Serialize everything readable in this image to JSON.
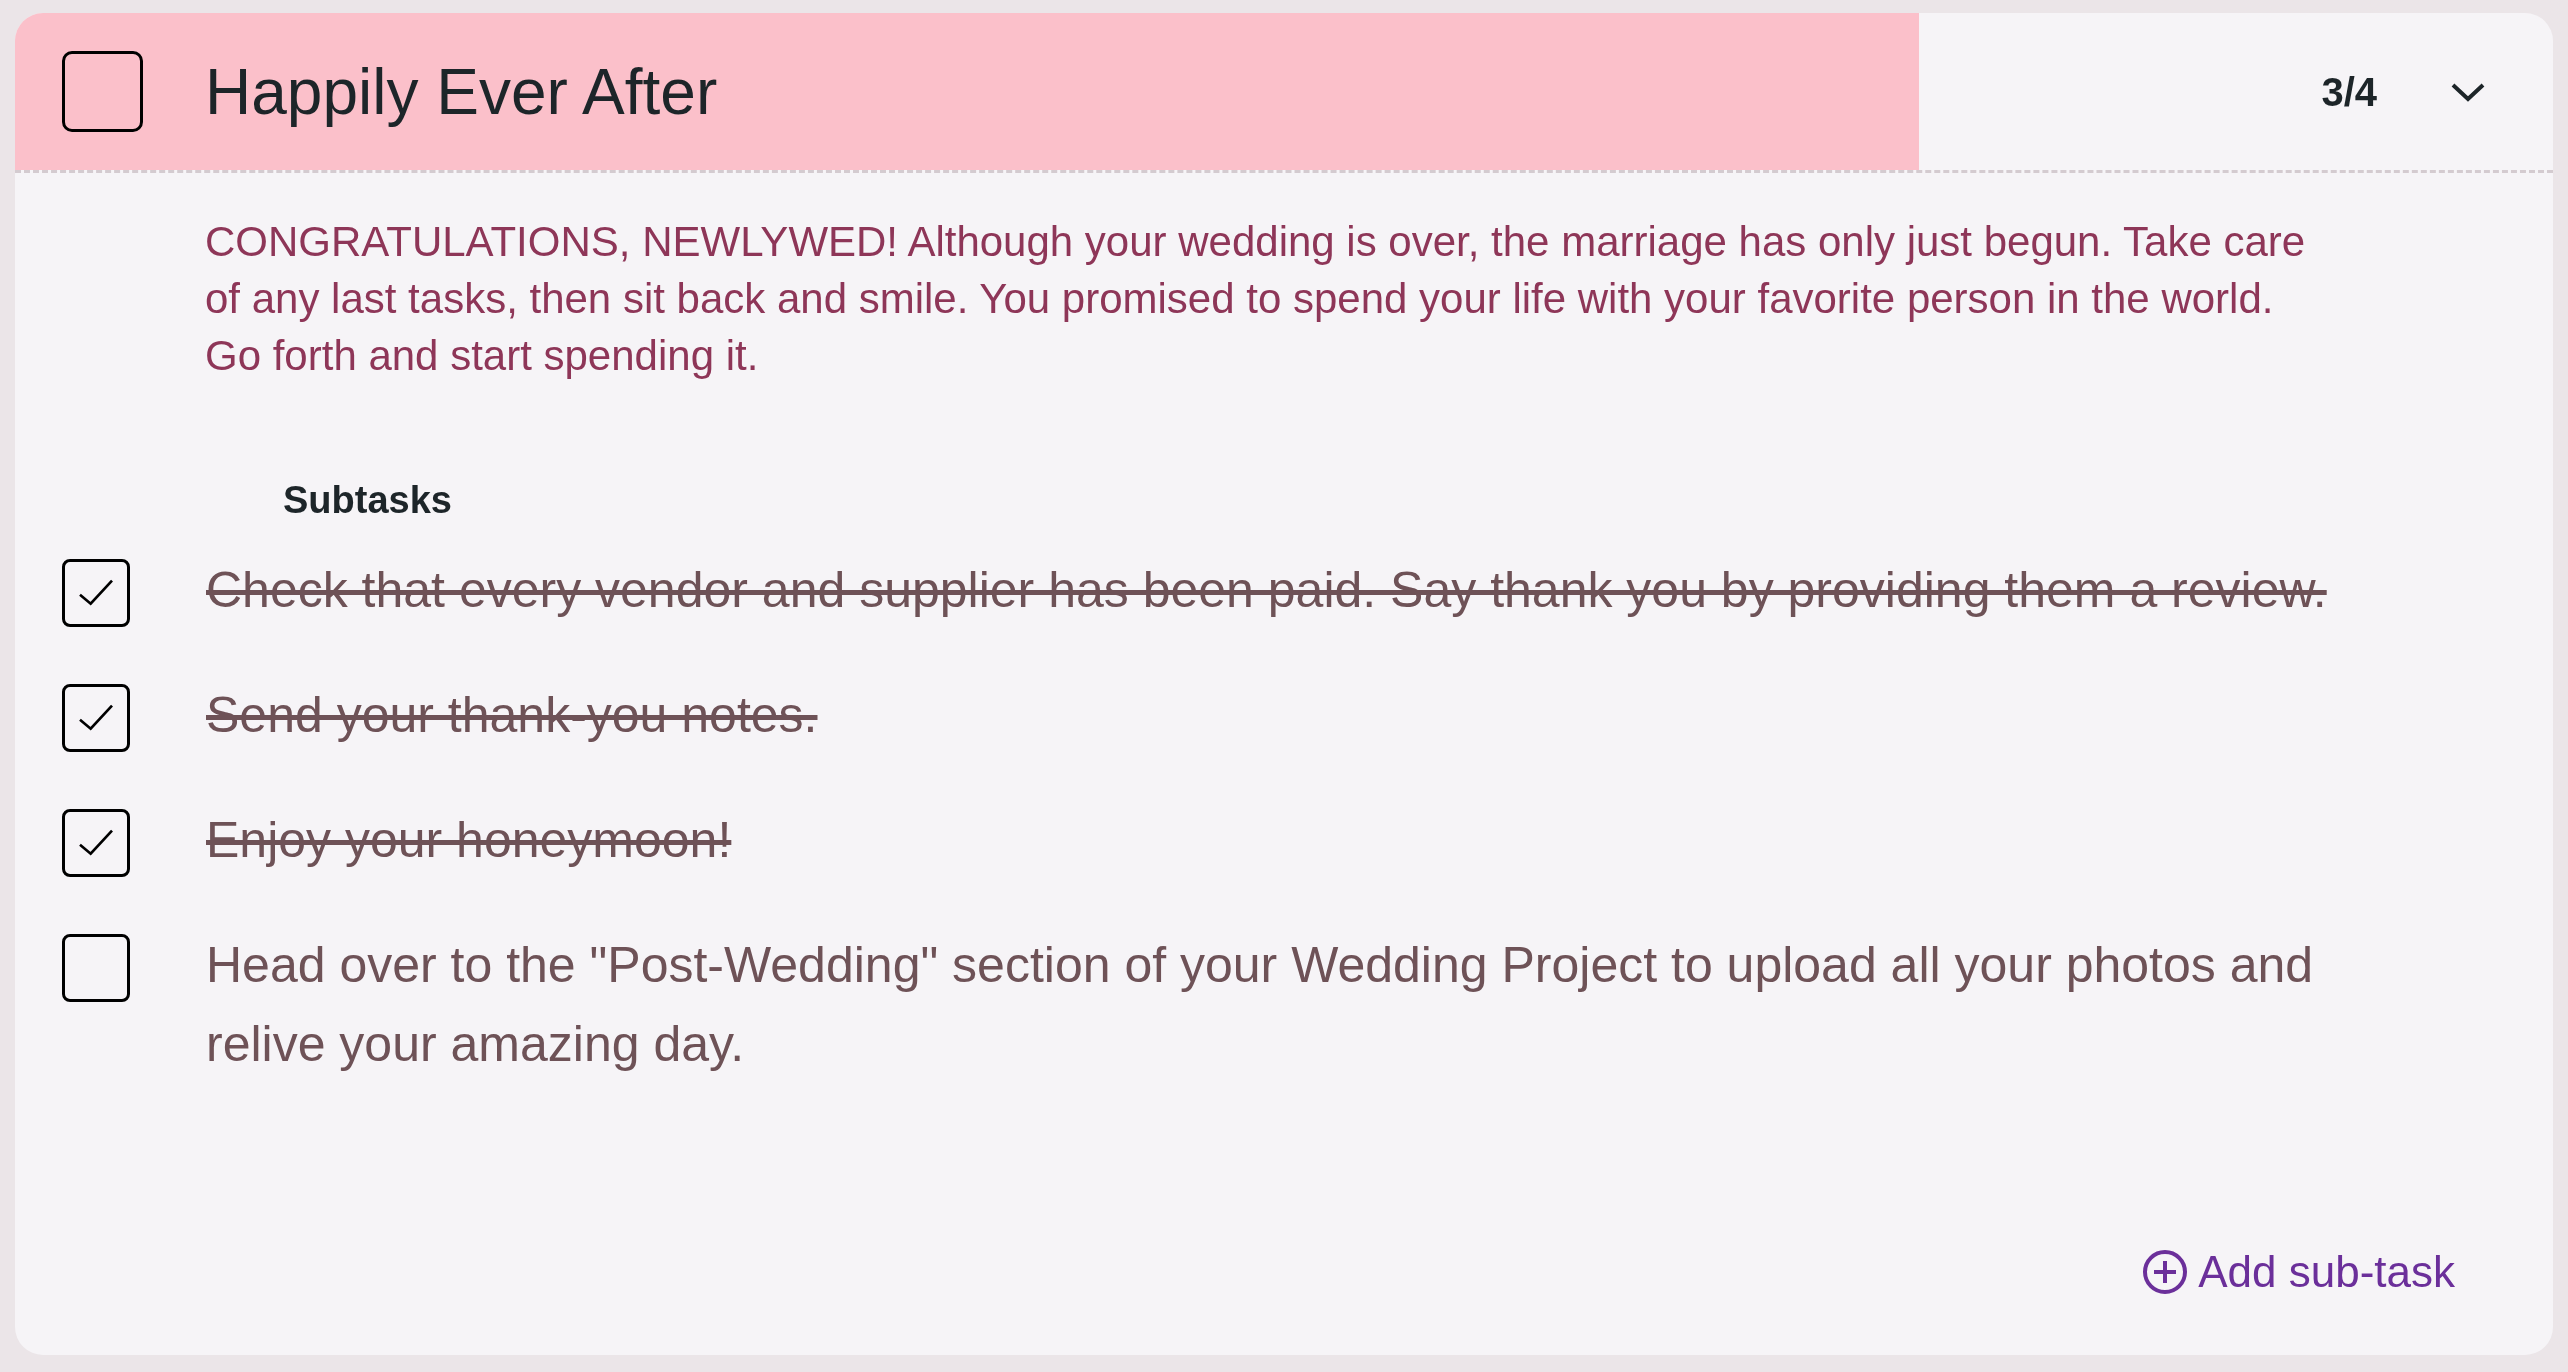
{
  "task": {
    "title": "Happily Ever After",
    "checked": false,
    "level": 0.75,
    "count": "3/4",
    "expanded": true,
    "description": "CONGRATULATIONS, NEWLYWED! Although your wedding is over, the marriage has only just begun. Take care of any last tasks, then sit back and smile. You promised to spend your life with your favorite person in the world. Go forth and start spending it."
  },
  "subtasks_heading": "Subtasks",
  "subtasks": [
    {
      "text": "Check that every vendor and supplier has been paid. Say thank you by providing them a review.",
      "checked": true
    },
    {
      "text": "Send your thank-you notes.",
      "checked": true
    },
    {
      "text": "Enjoy your honeymoon!",
      "checked": true
    },
    {
      "text": "Head over to the \"Post-Wedding\" section of your Wedding Project to upload all your photos and relive your amazing day.",
      "checked": false
    }
  ],
  "add_button": "Add sub-task"
}
